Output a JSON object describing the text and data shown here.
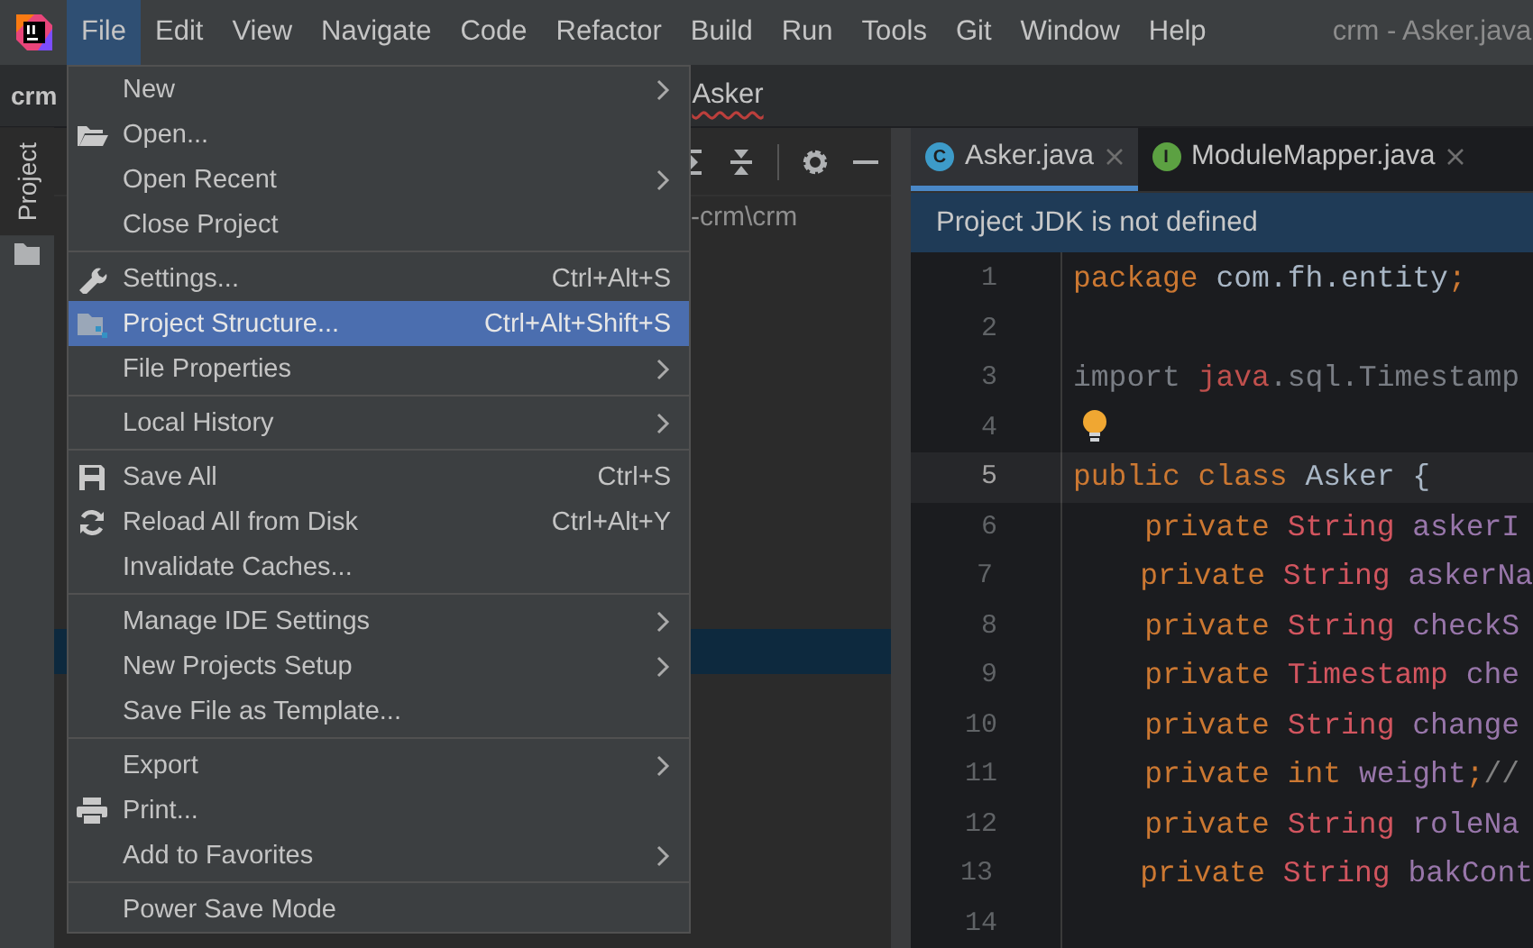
{
  "menubar": {
    "items": [
      {
        "label": "File",
        "selected": true
      },
      {
        "label": "Edit",
        "selected": false
      },
      {
        "label": "View",
        "selected": false
      },
      {
        "label": "Navigate",
        "selected": false
      },
      {
        "label": "Code",
        "selected": false
      },
      {
        "label": "Refactor",
        "selected": false
      },
      {
        "label": "Build",
        "selected": false
      },
      {
        "label": "Run",
        "selected": false
      },
      {
        "label": "Tools",
        "selected": false
      },
      {
        "label": "Git",
        "selected": false
      },
      {
        "label": "Window",
        "selected": false
      },
      {
        "label": "Help",
        "selected": false
      }
    ],
    "title": "crm - Asker.java"
  },
  "navbar": {
    "project": "crm",
    "file": "Asker"
  },
  "tool_strip": [
    {
      "label": "Project",
      "selected": true
    }
  ],
  "project_panel": {
    "path": "-crm\\crm"
  },
  "editor": {
    "tabs": [
      {
        "label": "Asker.java",
        "badge": "C",
        "kind": "class",
        "selected": true
      },
      {
        "label": "ModuleMapper.java",
        "badge": "I",
        "kind": "interface",
        "selected": false
      }
    ],
    "banner": "Project JDK is not defined",
    "lines": [
      {
        "number": "1",
        "current": false,
        "bulb": false,
        "tokens": [
          {
            "text": "package",
            "kind": "keyword"
          },
          {
            "text": " com.fh.entity",
            "kind": "plain"
          },
          {
            "text": ";",
            "kind": "keyword"
          }
        ]
      },
      {
        "number": "2",
        "current": false,
        "bulb": false
      },
      {
        "number": "3",
        "current": false,
        "bulb": false,
        "tokens": [
          {
            "text": "import ",
            "kind": "unused"
          },
          {
            "text": "java",
            "kind": "error"
          },
          {
            "text": ".sql.Timestamp",
            "kind": "unused"
          }
        ]
      },
      {
        "number": "4",
        "current": false,
        "bulb": true
      },
      {
        "number": "5",
        "current": true,
        "bulb": false,
        "tokens": [
          {
            "text": "public class ",
            "kind": "keyword"
          },
          {
            "text": "Asker {",
            "kind": "plain"
          }
        ]
      },
      {
        "number": "6",
        "current": false,
        "bulb": false,
        "tokens": [
          {
            "text": "    private ",
            "kind": "keyword"
          },
          {
            "text": "String ",
            "kind": "type"
          },
          {
            "text": "askerI",
            "kind": "field"
          }
        ]
      },
      {
        "number": "7",
        "current": false,
        "bulb": false,
        "tokens": [
          {
            "text": "    private ",
            "kind": "keyword"
          },
          {
            "text": "String ",
            "kind": "type"
          },
          {
            "text": "askerNa",
            "kind": "field"
          }
        ]
      },
      {
        "number": "8",
        "current": false,
        "bulb": false,
        "tokens": [
          {
            "text": "    private ",
            "kind": "keyword"
          },
          {
            "text": "String ",
            "kind": "type"
          },
          {
            "text": "checkS",
            "kind": "field"
          }
        ]
      },
      {
        "number": "9",
        "current": false,
        "bulb": false,
        "tokens": [
          {
            "text": "    private ",
            "kind": "keyword"
          },
          {
            "text": "Timestamp ",
            "kind": "type"
          },
          {
            "text": "che",
            "kind": "field"
          }
        ]
      },
      {
        "number": "10",
        "current": false,
        "bulb": false,
        "tokens": [
          {
            "text": "    private ",
            "kind": "keyword"
          },
          {
            "text": "String ",
            "kind": "type"
          },
          {
            "text": "change",
            "kind": "field"
          }
        ]
      },
      {
        "number": "11",
        "current": false,
        "bulb": false,
        "tokens": [
          {
            "text": "    private int ",
            "kind": "keyword"
          },
          {
            "text": "weight",
            "kind": "field"
          },
          {
            "text": ";",
            "kind": "keyword"
          },
          {
            "text": "//",
            "kind": "comment"
          }
        ]
      },
      {
        "number": "12",
        "current": false,
        "bulb": false,
        "tokens": [
          {
            "text": "    private ",
            "kind": "keyword"
          },
          {
            "text": "String ",
            "kind": "type"
          },
          {
            "text": "roleNa",
            "kind": "field"
          }
        ]
      },
      {
        "number": "13",
        "current": false,
        "bulb": false,
        "tokens": [
          {
            "text": "    private ",
            "kind": "keyword"
          },
          {
            "text": "String ",
            "kind": "type"
          },
          {
            "text": "bakCont",
            "kind": "field"
          }
        ]
      },
      {
        "number": "14",
        "current": false,
        "bulb": false
      }
    ]
  },
  "file_menu": {
    "groups": [
      [
        {
          "label": "New",
          "kind": "plain",
          "submenu": true,
          "selected": false
        },
        {
          "label": "Open...",
          "kind": "open",
          "submenu": false,
          "selected": false
        },
        {
          "label": "Open Recent",
          "kind": "plain",
          "submenu": true,
          "selected": false
        },
        {
          "label": "Close Project",
          "kind": "plain",
          "submenu": false,
          "selected": false
        }
      ],
      [
        {
          "label": "Settings...",
          "kind": "settings",
          "shortcut": "Ctrl+Alt+S",
          "submenu": false,
          "selected": false
        },
        {
          "label": "Project Structure...",
          "kind": "structure",
          "shortcut": "Ctrl+Alt+Shift+S",
          "submenu": false,
          "selected": true
        },
        {
          "label": "File Properties",
          "kind": "plain",
          "submenu": true,
          "selected": false
        }
      ],
      [
        {
          "label": "Local History",
          "kind": "plain",
          "submenu": true,
          "selected": false
        }
      ],
      [
        {
          "label": "Save All",
          "kind": "save",
          "shortcut": "Ctrl+S",
          "submenu": false,
          "selected": false
        },
        {
          "label": "Reload All from Disk",
          "kind": "reload",
          "shortcut": "Ctrl+Alt+Y",
          "submenu": false,
          "selected": false
        },
        {
          "label": "Invalidate Caches...",
          "kind": "plain",
          "submenu": false,
          "selected": false
        }
      ],
      [
        {
          "label": "Manage IDE Settings",
          "kind": "plain",
          "submenu": true,
          "selected": false
        },
        {
          "label": "New Projects Setup",
          "kind": "plain",
          "submenu": true,
          "selected": false
        },
        {
          "label": "Save File as Template...",
          "kind": "plain",
          "submenu": false,
          "selected": false
        }
      ],
      [
        {
          "label": "Export",
          "kind": "plain",
          "submenu": true,
          "selected": false
        },
        {
          "label": "Print...",
          "kind": "print",
          "submenu": false,
          "selected": false
        },
        {
          "label": "Add to Favorites",
          "kind": "plain",
          "submenu": true,
          "selected": false
        }
      ],
      [
        {
          "label": "Power Save Mode",
          "kind": "plain",
          "submenu": false,
          "selected": false
        }
      ]
    ]
  }
}
